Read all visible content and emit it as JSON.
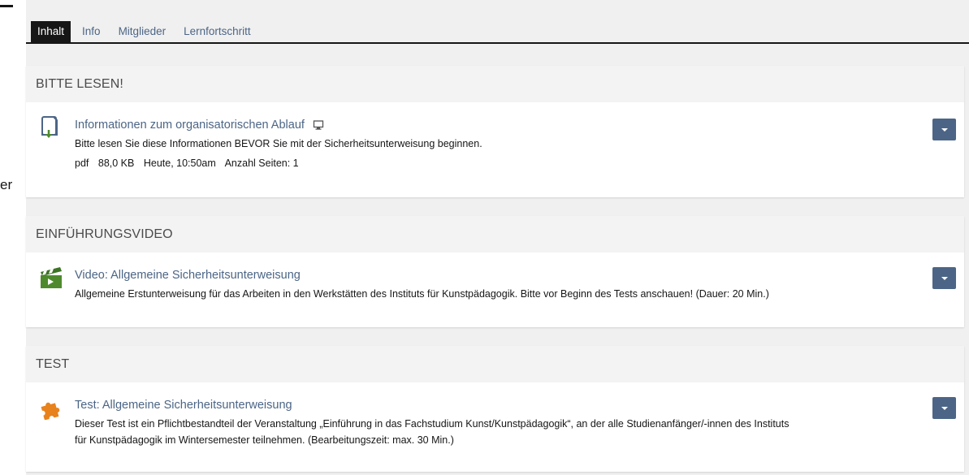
{
  "left_fragment": "er",
  "tabs": [
    {
      "label": "Inhalt",
      "active": true
    },
    {
      "label": "Info"
    },
    {
      "label": "Mitglieder"
    },
    {
      "label": "Lernfortschritt"
    }
  ],
  "blocks": [
    {
      "heading": "BITTE LESEN!",
      "item": {
        "icon": "file-download-icon",
        "title": "Informationen zum organisatorischen Ablauf",
        "title_icon": "monitor-icon",
        "description": "Bitte lesen Sie diese Informationen BEVOR Sie mit der Sicherheitsunterweisung beginnen.",
        "props": {
          "type": "pdf",
          "size": "88,0 KB",
          "date": "Heute, 10:50am",
          "pages": "Anzahl Seiten: 1"
        }
      }
    },
    {
      "heading": "EINFÜHRUNGSVIDEO",
      "item": {
        "icon": "video-clapperboard-icon",
        "title": "Video: Allgemeine Sicherheitsunterweisung",
        "description": "Allgemeine Erstunterweisung für das Arbeiten in den Werkstätten des Instituts für Kunstpädagogik. Bitte vor Beginn des Tests anschauen! (Dauer: 20 Min.)"
      }
    },
    {
      "heading": "TEST",
      "item": {
        "icon": "test-puzzle-icon",
        "title": "Test: Allgemeine Sicherheitsunterweisung",
        "description_line1": "Dieser Test ist ein Pflichtbestandteil der Veranstaltung „Einführung in das Fachstudium Kunst/Kunstpädagogik“, an der alle Studienanfänger/-innen des Instituts",
        "description_line2": "für Kunstpädagogik im Wintersemester teilnehmen. (Bearbeitungszeit: max. 30 Min.)"
      }
    }
  ],
  "colors": {
    "accent": "#4c6586",
    "tab_active_bg": "#161616",
    "header_bg": "#f3f3f3",
    "icon_green": "#4e8a2d",
    "icon_orange": "#e8821c"
  }
}
